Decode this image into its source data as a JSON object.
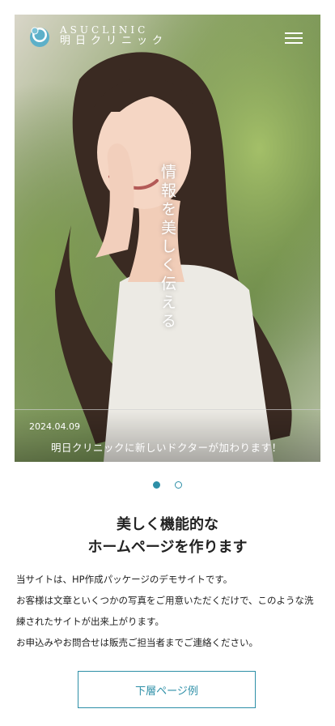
{
  "brand": {
    "name_en": "ASUCLINIC",
    "name_ja": "明日クリニック",
    "accent_color": "#2d8fa7"
  },
  "hero": {
    "catchphrase": "情報を美しく伝える",
    "news_date": "2024.04.09",
    "news_title": "明日クリニックに新しいドクターが加わります！"
  },
  "menu": {
    "icon": "hamburger-menu-icon"
  },
  "slider": {
    "total": 2,
    "active_index": 1
  },
  "intro": {
    "heading_line1": "美しく機能的な",
    "heading_line2": "ホームページを作ります",
    "paragraphs": [
      "当サイトは、HP作成パッケージのデモサイトです。",
      "お客様は文章といくつかの写真をご用意いただくだけで、このような洗練されたサイトが出来上がります。",
      "お申込みやお問合せは販売ご担当者までご連絡ください。"
    ]
  },
  "cta": {
    "label": "下層ページ例"
  }
}
